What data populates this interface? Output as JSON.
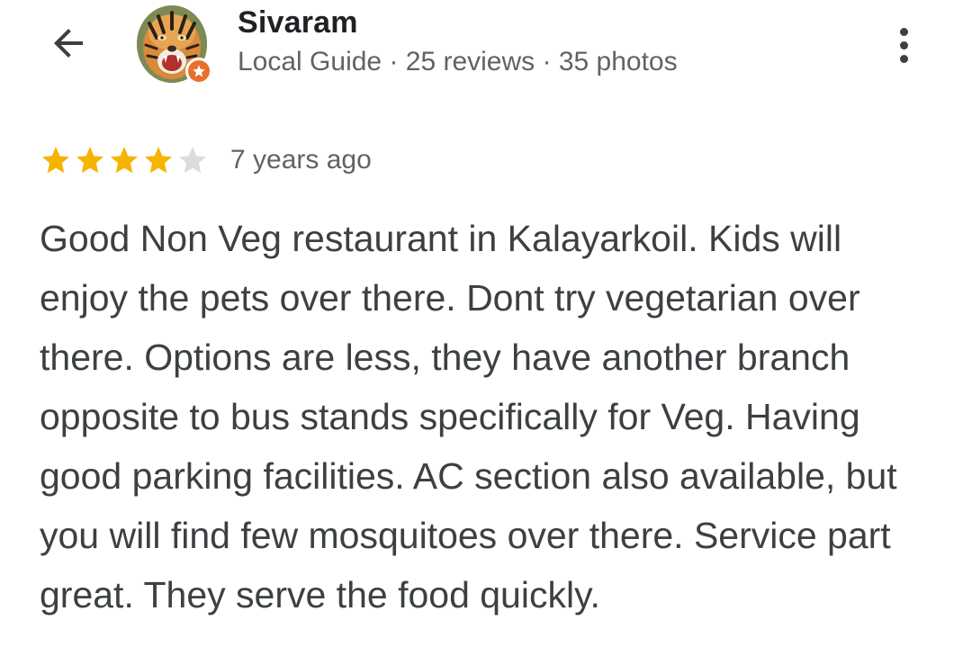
{
  "header": {
    "back_icon": "arrow-back-icon",
    "user": {
      "name": "Sivaram",
      "meta": "Local Guide · 25 reviews · 35 photos",
      "avatar_icon": "tiger-avatar",
      "badge_icon": "local-guide-star-icon"
    },
    "more_icon": "more-vert-icon"
  },
  "review": {
    "rating": 4,
    "rating_max": 5,
    "time": "7 years ago",
    "text": "Good Non Veg restaurant in Kalayarkoil. Kids will enjoy the pets over there. Dont try vegetarian over there. Options are less, they have another branch opposite to bus stands specifically for Veg. Having good parking facilities. AC section also available, but you will find few mosquitoes over there. Service part great. They serve the food quickly."
  },
  "colors": {
    "star_filled": "#f4b400",
    "star_empty": "#dadce0",
    "badge": "#e8702a",
    "name_text": "#202124",
    "meta_text": "#5f6368",
    "body_text": "#3c4043"
  }
}
